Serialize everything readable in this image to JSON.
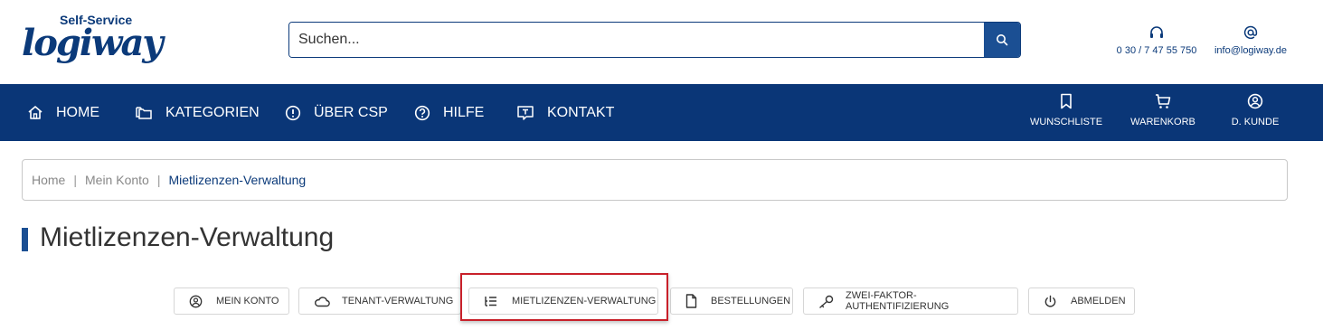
{
  "logo": {
    "sub": "Self-Service",
    "main": "logiway"
  },
  "search": {
    "placeholder": "Suchen..."
  },
  "contact": {
    "phone": "0 30 / 7 47 55 750",
    "email": "info@logiway.de"
  },
  "nav": {
    "items": [
      {
        "label": "HOME",
        "icon": "home-icon"
      },
      {
        "label": "KATEGORIEN",
        "icon": "folders-icon"
      },
      {
        "label": "ÜBER CSP",
        "icon": "info-circle-icon"
      },
      {
        "label": "HILFE",
        "icon": "question-circle-icon"
      },
      {
        "label": "KONTAKT",
        "icon": "chat-icon"
      }
    ],
    "right": [
      {
        "label": "WUNSCHLISTE",
        "icon": "bookmark-icon"
      },
      {
        "label": "WARENKORB",
        "icon": "cart-icon"
      },
      {
        "label": "D. KUNDE",
        "icon": "user-circle-icon"
      }
    ]
  },
  "breadcrumb": {
    "items": [
      "Home",
      "Mein Konto"
    ],
    "current": "Mietlizenzen-Verwaltung"
  },
  "page": {
    "title": "Mietlizenzen-Verwaltung"
  },
  "tabs": [
    {
      "label": "MEIN KONTO",
      "icon": "user-circle-icon"
    },
    {
      "label": "TENANT-VERWALTUNG",
      "icon": "cloud-icon"
    },
    {
      "label": "MIETLIZENZEN-VERWALTUNG",
      "icon": "list-tree-icon",
      "active": true
    },
    {
      "label": "BESTELLUNGEN",
      "icon": "document-icon"
    },
    {
      "label": "ZWEI-FAKTOR-AUTHENTIFIZIERUNG",
      "icon": "key-icon"
    },
    {
      "label": "ABMELDEN",
      "icon": "power-icon"
    }
  ],
  "colors": {
    "brand": "#0a3677",
    "accent": "#1b4f93",
    "highlight": "#c8202a"
  }
}
